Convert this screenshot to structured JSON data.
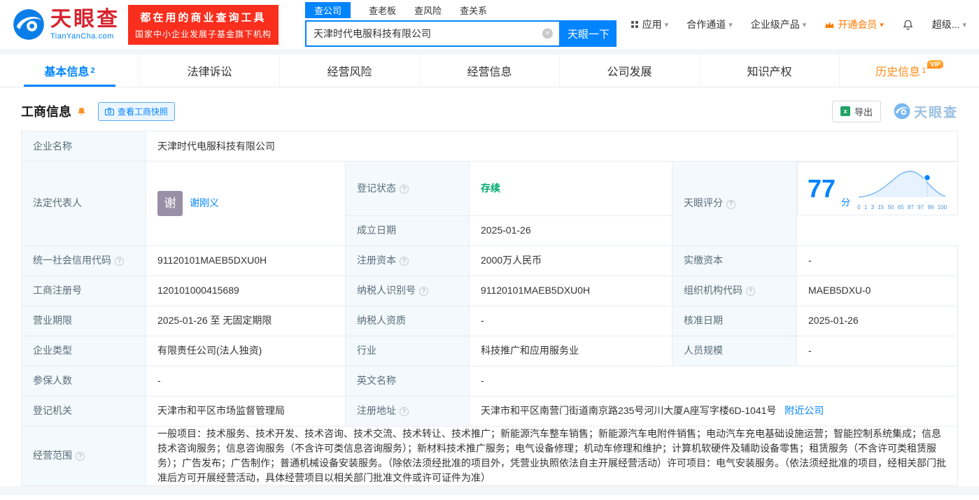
{
  "icons": {
    "help": "?",
    "clear": "×",
    "caret": "▾"
  },
  "colors": {
    "brand_blue": "#0084ff",
    "banner_red": "#f92e1d",
    "status_green": "#00a971",
    "vip_orange": "#ff8c19"
  },
  "header": {
    "logo": {
      "cn": "天眼查",
      "en": "TianYanCha.com"
    },
    "banner": {
      "line1": "都在用的商业查询工具",
      "line2": "国家中小企业发展子基金旗下机构"
    },
    "search": {
      "tabs": [
        {
          "label": "查公司"
        },
        {
          "label": "查老板"
        },
        {
          "label": "查风险"
        },
        {
          "label": "查关系"
        }
      ],
      "value": "天津时代电服科技有限公司",
      "button": "天眼一下"
    },
    "nav": [
      {
        "label": "应用"
      },
      {
        "label": "合作通道"
      },
      {
        "label": "企业级产品"
      },
      {
        "label": "开通会员"
      },
      {
        "label": "超级..."
      }
    ]
  },
  "tabs": [
    {
      "label": "基本信息",
      "badge": "2"
    },
    {
      "label": "法律诉讼"
    },
    {
      "label": "经营风险"
    },
    {
      "label": "经营信息"
    },
    {
      "label": "公司发展"
    },
    {
      "label": "知识产权"
    },
    {
      "label": "历史信息",
      "badge": "1",
      "tag": "VIP"
    }
  ],
  "section": {
    "title": "工商信息",
    "snapshot_button": "查看工商快照",
    "export_button": "导出",
    "watermark": "天眼查"
  },
  "table": {
    "company_name": {
      "label": "企业名称",
      "value": "天津时代电服科技有限公司"
    },
    "legal_rep": {
      "label": "法定代表人",
      "avatar": "谢",
      "name": "谢刚义"
    },
    "reg_status": {
      "label": "登记状态",
      "value": "存续"
    },
    "establish_date": {
      "label": "成立日期",
      "value": "2025-01-26"
    },
    "score": {
      "label": "天眼评分",
      "value": "77",
      "unit": "分",
      "axis": [
        "0",
        "1",
        "3",
        "15",
        "50",
        "65",
        "87",
        "97",
        "99",
        "100"
      ]
    },
    "credit_code": {
      "label": "统一社会信用代码",
      "value": "91120101MAEB5DXU0H"
    },
    "reg_capital": {
      "label": "注册资本",
      "value": "2000万人民币"
    },
    "paid_capital": {
      "label": "实缴资本",
      "value": "-"
    },
    "reg_number": {
      "label": "工商注册号",
      "value": "120101000415689"
    },
    "taxpayer_id": {
      "label": "纳税人识别号",
      "value": "91120101MAEB5DXU0H"
    },
    "org_code": {
      "label": "组织机构代码",
      "value": "MAEB5DXU-0"
    },
    "business_term": {
      "label": "营业期限",
      "value": "2025-01-26 至 无固定期限"
    },
    "taxpayer_quality": {
      "label": "纳税人资质",
      "value": "-"
    },
    "approval_date": {
      "label": "核准日期",
      "value": "2025-01-26"
    },
    "company_type": {
      "label": "企业类型",
      "value": "有限责任公司(法人独资)"
    },
    "industry": {
      "label": "行业",
      "value": "科技推广和应用服务业"
    },
    "staff_size": {
      "label": "人员规模",
      "value": "-"
    },
    "insured_count": {
      "label": "参保人数",
      "value": "-"
    },
    "english_name": {
      "label": "英文名称",
      "value": "-"
    },
    "reg_authority": {
      "label": "登记机关",
      "value": "天津市和平区市场监督管理局"
    },
    "reg_address": {
      "label": "注册地址",
      "value": "天津市和平区南营门街道南京路235号河川大厦A座写字楼6D-1041号",
      "link": "附近公司"
    },
    "business_scope": {
      "label": "经营范围",
      "value": "一般项目：技术服务、技术开发、技术咨询、技术交流、技术转让、技术推广；新能源汽车整车销售；新能源汽车电附件销售；电动汽车充电基础设施运营；智能控制系统集成；信息技术咨询服务；信息咨询服务（不含许可类信息咨询服务）；新材料技术推广服务；电气设备修理；机动车修理和维护；计算机软硬件及辅助设备零售；租赁服务（不含许可类租赁服务）；广告发布；广告制作；普通机械设备安装服务。（除依法须经批准的项目外，凭营业执照依法自主开展经营活动）许可项目：电气安装服务。（依法须经批准的项目，经相关部门批准后方可开展经营活动，具体经营项目以相关部门批准文件或许可证件为准）"
    }
  }
}
